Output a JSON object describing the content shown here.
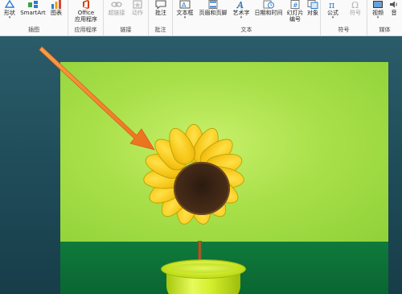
{
  "ribbon": {
    "groups": [
      {
        "label": "插图",
        "buttons": [
          {
            "label": "形状",
            "icon": "shapes-icon",
            "dropdown": true
          },
          {
            "label": "SmartArt",
            "icon": "smartart-icon",
            "dropdown": false
          },
          {
            "label": "图表",
            "icon": "chart-icon",
            "dropdown": false
          }
        ]
      },
      {
        "label": "应用程序",
        "buttons": [
          {
            "label": "Office",
            "label2": "应用程序",
            "icon": "office-icon",
            "dropdown": true
          }
        ]
      },
      {
        "label": "链接",
        "buttons": [
          {
            "label": "超链接",
            "icon": "hyperlink-icon",
            "disabled": true
          },
          {
            "label": "动作",
            "icon": "action-icon",
            "disabled": true
          }
        ]
      },
      {
        "label": "批注",
        "buttons": [
          {
            "label": "批注",
            "icon": "comment-icon"
          }
        ]
      },
      {
        "label": "文本",
        "buttons": [
          {
            "label": "文本框",
            "icon": "textbox-icon",
            "dropdown": true
          },
          {
            "label": "页眉和页脚",
            "icon": "header-footer-icon"
          },
          {
            "label": "艺术字",
            "icon": "wordart-icon",
            "dropdown": true
          },
          {
            "label": "日期和时间",
            "icon": "date-time-icon"
          },
          {
            "label": "幻灯片",
            "label2": "编号",
            "icon": "slide-number-icon"
          },
          {
            "label": "对象",
            "icon": "object-icon"
          }
        ]
      },
      {
        "label": "符号",
        "buttons": [
          {
            "label": "公式",
            "icon": "equation-icon",
            "dropdown": true
          },
          {
            "label": "符号",
            "icon": "symbol-icon",
            "disabled": true
          }
        ]
      },
      {
        "label": "媒体",
        "buttons": [
          {
            "label": "视频",
            "icon": "video-icon",
            "dropdown": true
          },
          {
            "label": "音",
            "icon": "audio-icon"
          }
        ]
      }
    ]
  },
  "colors": {
    "accent_blue": "#2b7cd3",
    "arrow_orange": "#f07c28",
    "slide_green": "#a9e04a",
    "table_green": "#0f7a3c",
    "workspace": "#1f4b58"
  }
}
